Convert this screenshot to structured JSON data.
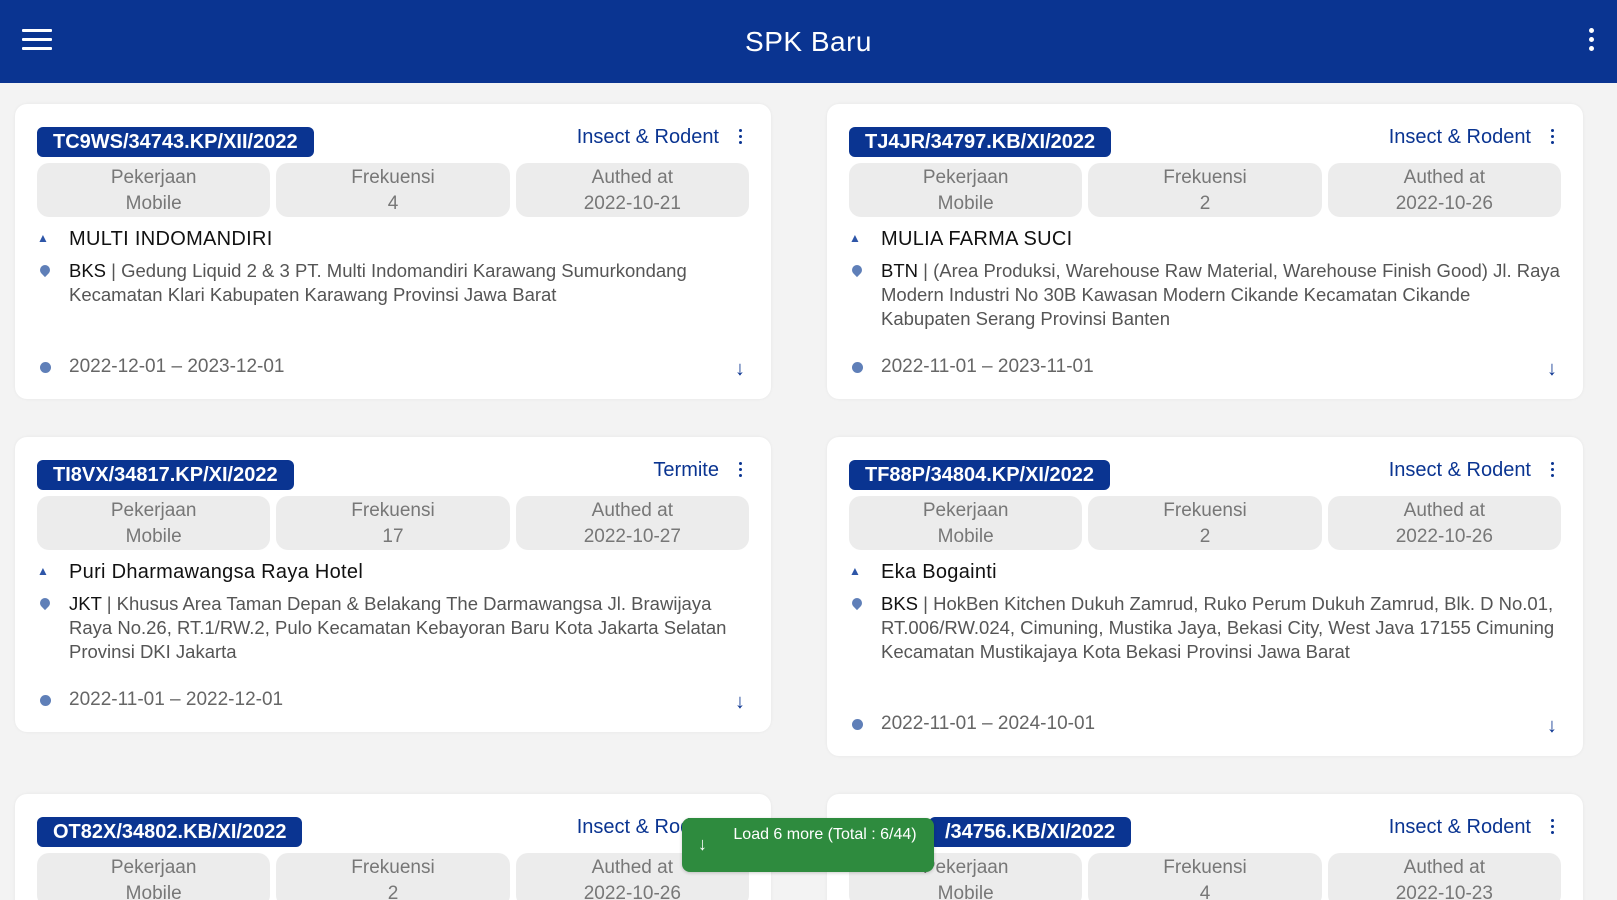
{
  "app": {
    "title": "SPK Baru",
    "menu_icon": "hamburger-menu-icon",
    "overflow_icon": "vertical-ellipsis-icon",
    "accent_color": "#0a3491",
    "load_more_color": "#2e8b3e"
  },
  "labels": {
    "pekerjaan": "Pekerjaan",
    "frekuensi": "Frekuensi",
    "authed_at": "Authed at"
  },
  "cards": [
    {
      "code": "TC9WS/34743.KP/XII/2022",
      "category": "Insect & Rodent",
      "pekerjaan": "Mobile",
      "frekuensi": "4",
      "authed_at": "2022-10-21",
      "client": "MULTI INDOMANDIRI",
      "branch": "BKS",
      "address": " | Gedung Liquid 2 & 3 PT. Multi Indomandiri Karawang Sumurkondang Kecamatan Klari Kabupaten Karawang Provinsi Jawa Barat",
      "period": "2022-12-01 – 2023-12-01"
    },
    {
      "code": "TJ4JR/34797.KB/XI/2022",
      "category": "Insect & Rodent",
      "pekerjaan": "Mobile",
      "frekuensi": "2",
      "authed_at": "2022-10-26",
      "client": "MULIA FARMA SUCI",
      "branch": "BTN",
      "address": " | (Area Produksi, Warehouse Raw  Material, Warehouse Finish Good) Jl. Raya Modern Industri No 30B Kawasan Modern  Cikande Kecamatan Cikande Kabupaten Serang Provinsi Banten",
      "period": "2022-11-01 – 2023-11-01"
    },
    {
      "code": "TI8VX/34817.KP/XI/2022",
      "category": "Termite",
      "pekerjaan": "Mobile",
      "frekuensi": "17",
      "authed_at": "2022-10-27",
      "client": "Puri Dharmawangsa Raya Hotel",
      "branch": "JKT",
      "address": " | Khusus Area Taman Depan & Belakang The Darmawangsa Jl. Brawijaya Raya No.26, RT.1/RW.2,   Pulo Kecamatan Kebayoran Baru Kota Jakarta Selatan Provinsi DKI Jakarta",
      "period": "2022-11-01 – 2022-12-01"
    },
    {
      "code": "TF88P/34804.KP/XI/2022",
      "category": "Insect & Rodent",
      "pekerjaan": "Mobile",
      "frekuensi": "2",
      "authed_at": "2022-10-26",
      "client": "Eka Bogainti",
      "branch": "BKS",
      "address": " | HokBen Kitchen Dukuh Zamrud, Ruko Perum Dukuh Zamrud, Blk. D No.01, RT.006/RW.024, Cimuning, Mustika Jaya, Bekasi City, West Java 17155  Cimuning Kecamatan Mustikajaya Kota Bekasi Provinsi Jawa Barat",
      "period": "2022-11-01 – 2024-10-01"
    },
    {
      "code": "OT82X/34802.KB/XI/2022",
      "category": "Insect & Rodent",
      "pekerjaan": "Mobile",
      "frekuensi": "2",
      "authed_at": "2022-10-26"
    },
    {
      "code": "/34756.KB/XI/2022",
      "category": "Insect & Rodent",
      "pekerjaan": "Mobile",
      "frekuensi": "4",
      "authed_at": "2022-10-23"
    }
  ],
  "load_more": {
    "label": "Load 6 more (Total : 6/44)",
    "icon": "arrow-down-icon"
  }
}
